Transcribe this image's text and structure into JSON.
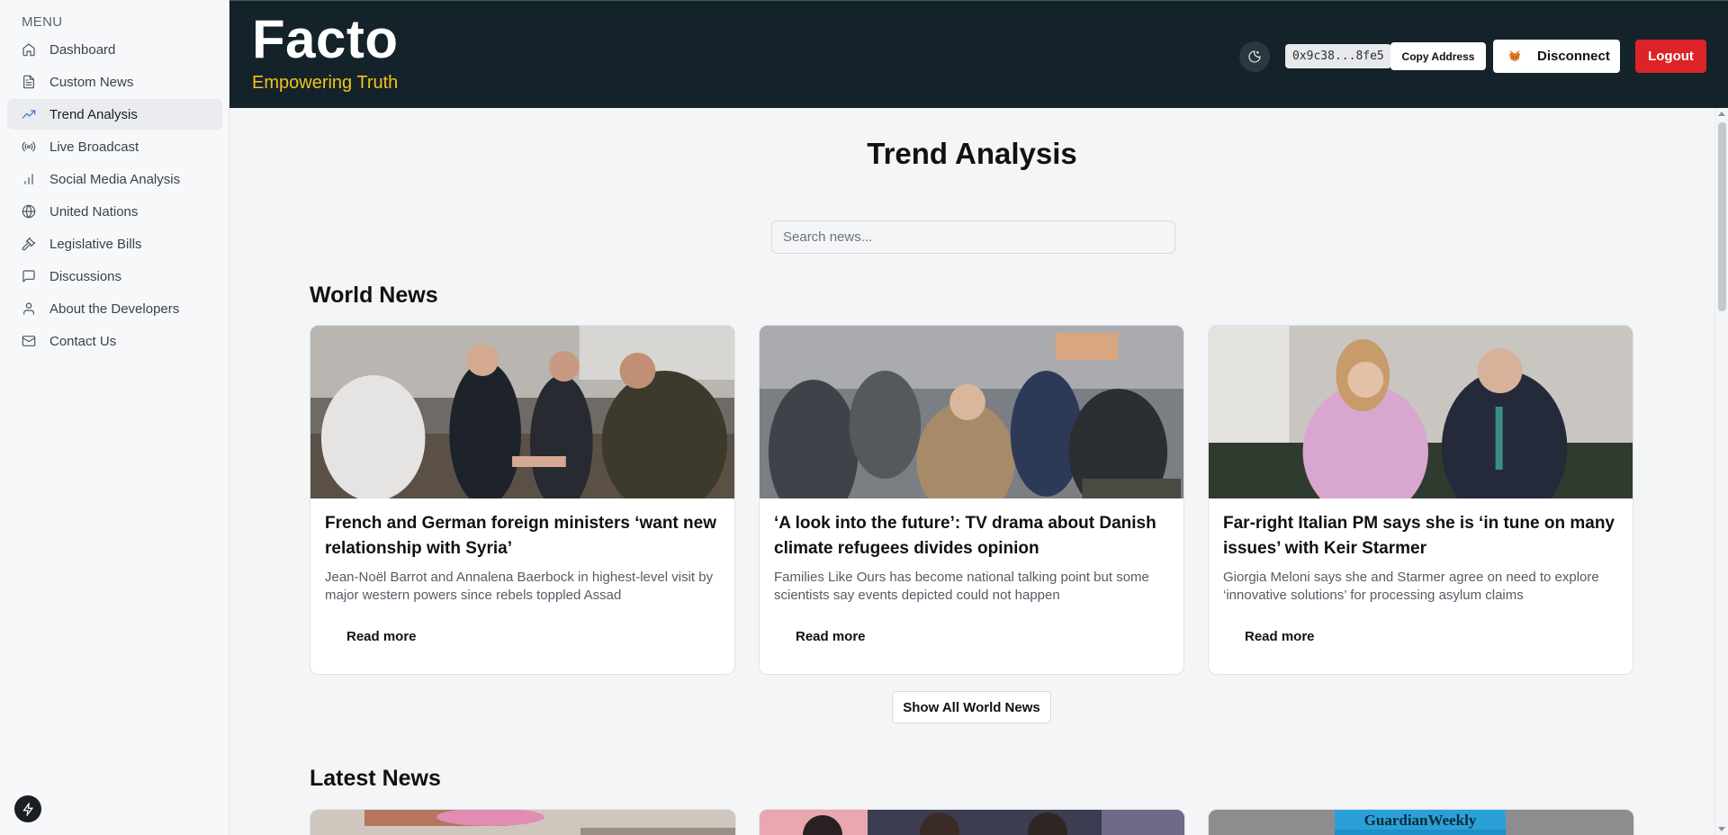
{
  "sidebar": {
    "menu_title": "MENU",
    "items": [
      {
        "label": "Dashboard",
        "icon": "home-icon"
      },
      {
        "label": "Custom News",
        "icon": "document-icon"
      },
      {
        "label": "Trend Analysis",
        "icon": "trending-up-icon",
        "active": true
      },
      {
        "label": "Live Broadcast",
        "icon": "broadcast-icon"
      },
      {
        "label": "Social Media Analysis",
        "icon": "bar-chart-icon"
      },
      {
        "label": "United Nations",
        "icon": "globe-icon"
      },
      {
        "label": "Legislative Bills",
        "icon": "gavel-icon"
      },
      {
        "label": "Discussions",
        "icon": "message-square-icon"
      },
      {
        "label": "About the Developers",
        "icon": "user-icon"
      },
      {
        "label": "Contact Us",
        "icon": "mail-icon"
      }
    ]
  },
  "header": {
    "brand": "Facto",
    "tagline": "Empowering Truth",
    "wallet_address": "0x9c38...8fe5",
    "copy_label": "Copy Address",
    "disconnect_label": "Disconnect",
    "logout_label": "Logout"
  },
  "main": {
    "title": "Trend Analysis",
    "search_placeholder": "Search news...",
    "world_news": {
      "title": "World News",
      "cards": [
        {
          "title": "French and German foreign ministers ‘want new relationship with Syria’",
          "description": "Jean-Noël Barrot and Annalena Baerbock in highest-level visit by major western powers since rebels toppled Assad",
          "link_label": "Read more"
        },
        {
          "title": "‘A look into the future’: TV drama about Danish climate refugees divides opinion",
          "description": "Families Like Ours has become national talking point but some scientists say events depicted could not happen",
          "link_label": "Read more"
        },
        {
          "title": "Far-right Italian PM says she is ‘in tune on many issues’ with Keir Starmer",
          "description": "Giorgia Meloni says she and Starmer agree on need to explore ‘innovative solutions’ for processing asylum claims",
          "link_label": "Read more"
        }
      ],
      "show_all_label": "Show All World News"
    },
    "latest_news": {
      "title": "Latest News"
    }
  },
  "colors": {
    "header_bg": "#14222a",
    "tagline": "#f0c419",
    "logout": "#dc2328",
    "active_icon": "#3a6fd8"
  }
}
